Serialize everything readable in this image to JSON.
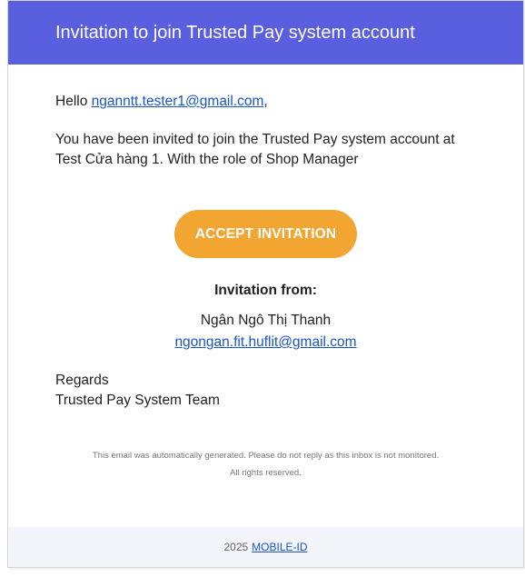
{
  "header": {
    "title": "Invitation to join Trusted Pay system account"
  },
  "greeting": {
    "prefix": "Hello ",
    "email": "nganntt.tester1@gmail.com",
    "suffix": ","
  },
  "intro": {
    "text": "You have been invited to join the Trusted Pay system account at Test Cửa hàng 1. With the role of Shop Manager"
  },
  "button": {
    "label": "ACCEPT INVITATION",
    "color": "#f3a531"
  },
  "inviter": {
    "title": "Invitation from:",
    "name": "Ngân Ngô Thị Thanh",
    "email": "ngongan.fit.huflit@gmail.com"
  },
  "signoff": {
    "regards": "Regards",
    "team": "Trusted Pay System Team"
  },
  "disclaimer": {
    "line1": "This email was automatically generated. Please do not reply as this inbox is not monitored.",
    "line2": "All rights reserved."
  },
  "footer": {
    "year": "2025",
    "brand": "MOBILE-ID"
  },
  "colors": {
    "header_bg": "#5a5fe0",
    "link": "#1a55c7",
    "footer_bg": "#f3f5fb"
  }
}
